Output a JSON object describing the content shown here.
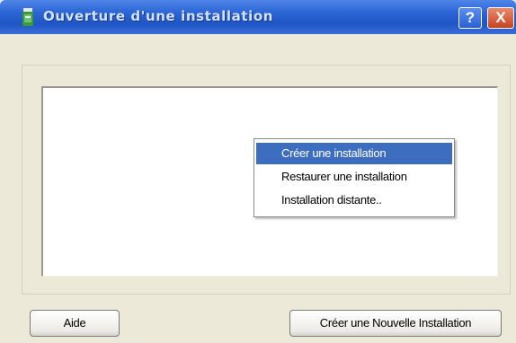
{
  "window": {
    "title": "Ouverture d'une installation",
    "help_button": "?",
    "close_button": "X"
  },
  "context_menu": {
    "items": [
      {
        "label": "Créer une installation",
        "selected": true
      },
      {
        "label": "Restaurer une installation",
        "selected": false
      },
      {
        "label": "Installation distante..",
        "selected": false
      }
    ]
  },
  "buttons": {
    "help_label": "Aide",
    "create_label": "Créer une Nouvelle Installation"
  },
  "icons": {
    "app": "installation-app-icon"
  }
}
